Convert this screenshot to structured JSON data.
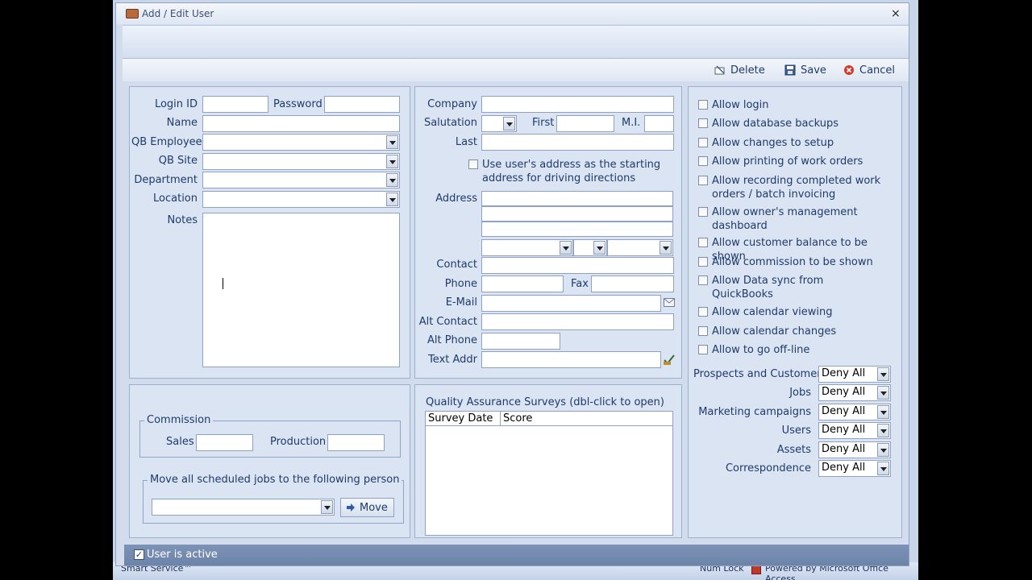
{
  "window": {
    "title": "Add / Edit User",
    "close_glyph": "×"
  },
  "toolbar": {
    "delete": "Delete",
    "save": "Save",
    "cancel": "Cancel"
  },
  "user": {
    "login_id_label": "Login ID",
    "login_id": "",
    "password_label": "Password",
    "password": "",
    "name_label": "Name",
    "name": "",
    "qb_employee_label": "QB Employee",
    "qb_employee": "",
    "qb_site_label": "QB Site",
    "qb_site": "",
    "department_label": "Department",
    "department": "",
    "location_label": "Location",
    "location": "",
    "notes_label": "Notes",
    "notes": ""
  },
  "commission": {
    "title": "Commission",
    "sales_label": "Sales",
    "sales": "",
    "production_label": "Production",
    "production": ""
  },
  "move_jobs": {
    "title": "Move all scheduled jobs to the following person",
    "person": "",
    "button": "Move"
  },
  "contact": {
    "company_label": "Company",
    "company": "",
    "salutation_label": "Salutation",
    "salutation": "",
    "first_label": "First",
    "first": "",
    "mi_label": "M.I.",
    "mi": "",
    "last_label": "Last",
    "last": "",
    "use_address_label": "Use user's address as the starting address for driving directions",
    "address_label": "Address",
    "contact_label": "Contact",
    "contact": "",
    "phone_label": "Phone",
    "phone": "",
    "fax_label": "Fax",
    "fax": "",
    "email_label": "E-Mail",
    "email": "",
    "alt_contact_label": "Alt Contact",
    "alt_contact": "",
    "alt_phone_label": "Alt Phone",
    "alt_phone": "",
    "text_addr_label": "Text Addr",
    "text_addr": ""
  },
  "qa": {
    "title": "Quality Assurance Surveys (dbl-click to open)",
    "columns": [
      "Survey Date",
      "Score"
    ]
  },
  "permissions": [
    "Allow login",
    "Allow database backups",
    "Allow changes to setup",
    "Allow printing of work orders",
    "Allow recording completed work orders / batch invoicing",
    "Allow owner's management dashboard",
    "Allow customer balance to be shown",
    "Allow commission to be shown",
    "Allow Data sync from QuickBooks",
    "Allow calendar viewing",
    "Allow calendar changes",
    "Allow to go off-line"
  ],
  "access": [
    {
      "label": "Prospects and Customers",
      "value": "Deny All"
    },
    {
      "label": "Jobs",
      "value": "Deny All"
    },
    {
      "label": "Marketing campaigns",
      "value": "Deny All"
    },
    {
      "label": "Users",
      "value": "Deny All"
    },
    {
      "label": "Assets",
      "value": "Deny All"
    },
    {
      "label": "Correspondence",
      "value": "Deny All"
    }
  ],
  "footer": {
    "active_label": "User is active",
    "active_checked": "✓"
  },
  "status": {
    "app_name": "Smart Service™",
    "num_lock": "Num Lock",
    "powered_by": "Powered by Microsoft Office Access"
  }
}
